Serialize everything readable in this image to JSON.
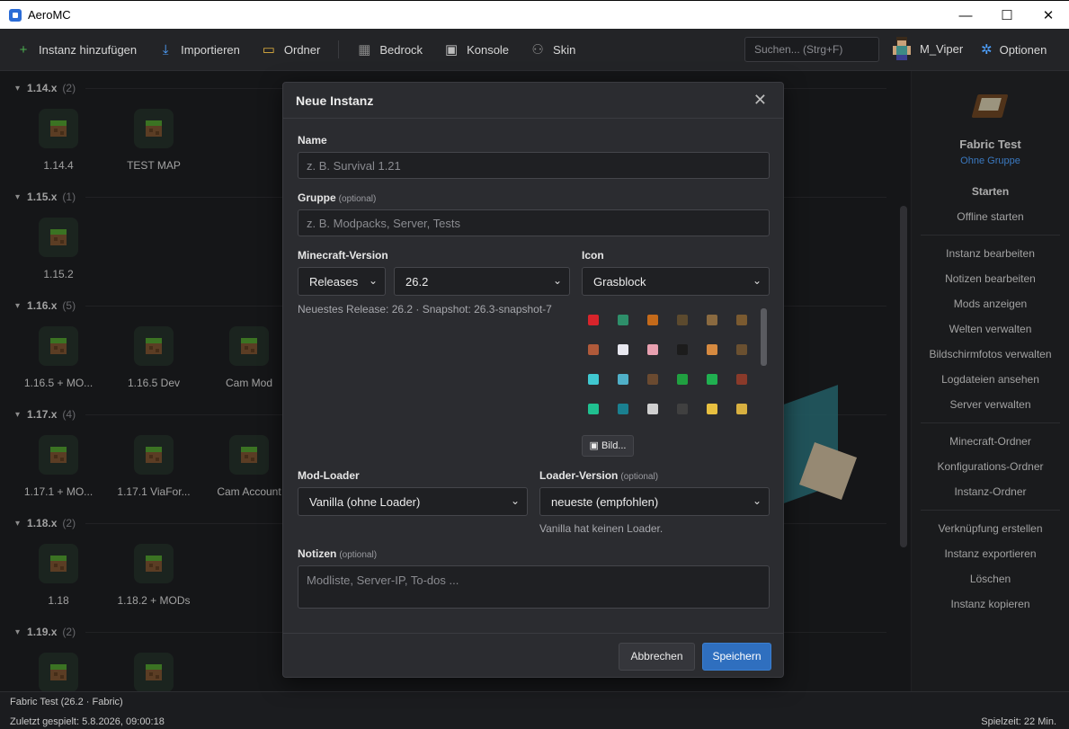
{
  "window": {
    "title": "AeroMC",
    "minimize": "—",
    "maximize": "☐",
    "close": "✕"
  },
  "toolbar": {
    "add_instance": "Instanz hinzufügen",
    "import": "Importieren",
    "folder": "Ordner",
    "bedrock": "Bedrock",
    "console": "Konsole",
    "skin": "Skin",
    "search_placeholder": "Suchen... (Strg+F)",
    "username": "M_Viper",
    "options": "Optionen"
  },
  "groups": [
    {
      "version": "1.14.x",
      "count": "(2)",
      "instances": [
        "1.14.4",
        "TEST MAP"
      ]
    },
    {
      "version": "1.15.x",
      "count": "(1)",
      "instances": [
        "1.15.2"
      ]
    },
    {
      "version": "1.16.x",
      "count": "(5)",
      "instances": [
        "1.16.5 + MO...",
        "1.16.5 Dev",
        "Cam Mod"
      ]
    },
    {
      "version": "1.17.x",
      "count": "(4)",
      "instances": [
        "1.17.1 + MO...",
        "1.17.1 ViaFor...",
        "Cam Account"
      ]
    },
    {
      "version": "1.18.x",
      "count": "(2)",
      "instances": [
        "1.18",
        "1.18.2 + MODs"
      ]
    },
    {
      "version": "1.19.x",
      "count": "(2)",
      "instances": [
        "",
        ""
      ]
    }
  ],
  "sidebar": {
    "instance_name": "Fabric Test",
    "instance_group": "Ohne Gruppe",
    "actions_1": [
      "Starten",
      "Offline starten"
    ],
    "actions_2": [
      "Instanz bearbeiten",
      "Notizen bearbeiten",
      "Mods anzeigen",
      "Welten verwalten",
      "Bildschirmfotos verwalten",
      "Logdateien ansehen",
      "Server verwalten"
    ],
    "actions_3": [
      "Minecraft-Ordner",
      "Konfigurations-Ordner",
      "Instanz-Ordner"
    ],
    "actions_4": [
      "Verknüpfung erstellen",
      "Instanz exportieren",
      "Löschen",
      "Instanz kopieren"
    ]
  },
  "status": {
    "instance_info": "Fabric Test (26.2 · Fabric)",
    "last_played": "Zuletzt gespielt: 5.8.2026, 09:00:18",
    "playtime": "Spielzeit: 22 Min."
  },
  "dialog": {
    "title": "Neue Instanz",
    "name_label": "Name",
    "name_placeholder": "z. B. Survival 1.21",
    "group_label": "Gruppe",
    "group_optional": "(optional)",
    "group_placeholder": "z. B. Modpacks, Server, Tests",
    "mc_version_label": "Minecraft-Version",
    "release_type": "Releases",
    "version": "26.2",
    "version_hint": "Neuestes Release: 26.2 · Snapshot: 26.3-snapshot-7",
    "icon_label": "Icon",
    "icon_value": "Grasblock",
    "icon_image_button": "Bild...",
    "modloader_label": "Mod-Loader",
    "modloader_value": "Vanilla (ohne Loader)",
    "loader_version_label": "Loader-Version",
    "loader_version_optional": "(optional)",
    "loader_version_value": "neueste (empfohlen)",
    "loader_hint": "Vanilla hat keinen Loader.",
    "notes_label": "Notizen",
    "notes_optional": "(optional)",
    "notes_placeholder": "Modliste, Server-IP, To-dos ...",
    "cancel": "Abbrechen",
    "save": "Speichern"
  },
  "icon_palette": [
    [
      "#d8242b",
      "#2e8f6a",
      "#c46a1a",
      "#5c4a2e",
      "#8a6a40",
      "#7a5a30"
    ],
    [
      "#b05a3a",
      "#e8e8f0",
      "#e8a0b0",
      "#1c1c1c",
      "#d68a40",
      "#6a5030"
    ],
    [
      "#40c8d0",
      "#50b0c8",
      "#6a4a30",
      "#20a040",
      "#20b050",
      "#8a3a2a"
    ],
    [
      "#20c090",
      "#1a8090",
      "#d0d0d0",
      "#404040",
      "#e8c040",
      "#d8b040"
    ]
  ]
}
